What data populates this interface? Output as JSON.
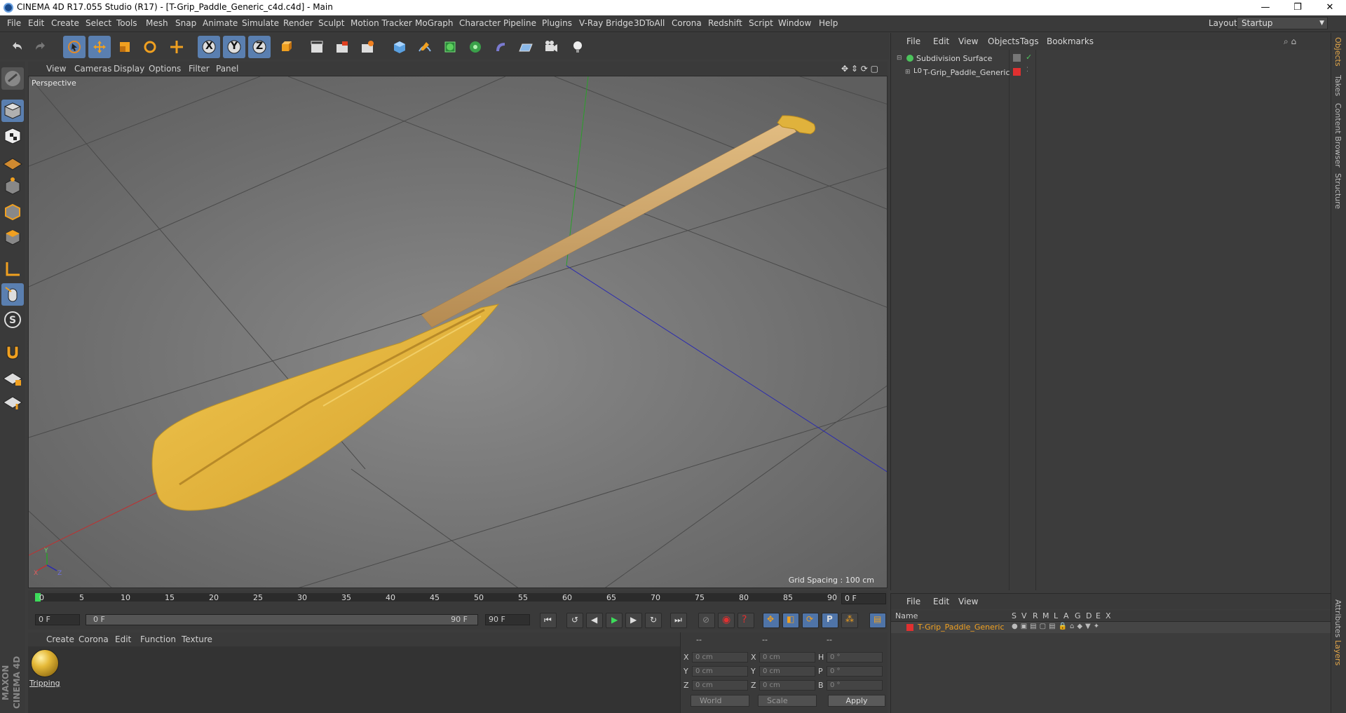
{
  "window": {
    "title": "CINEMA 4D R17.055 Studio (R17) - [T-Grip_Paddle_Generic_c4d.c4d] - Main",
    "controls": {
      "minimize": "—",
      "restore": "❐",
      "close": "✕"
    }
  },
  "menubar": {
    "items": [
      "File",
      "Edit",
      "Create",
      "Select",
      "Tools",
      "Mesh",
      "Snap",
      "Animate",
      "Simulate",
      "Render",
      "Sculpt",
      "Motion Tracker",
      "MoGraph",
      "Character",
      "Pipeline",
      "Plugins",
      "V-Ray Bridge",
      "3DToAll",
      "Corona",
      "Redshift",
      "Script",
      "Window",
      "Help"
    ],
    "layout_label": "Layout:",
    "layout_value": "Startup"
  },
  "toolbar": {
    "axis_labels": [
      "X",
      "Y",
      "Z"
    ]
  },
  "viewport": {
    "menu": [
      "View",
      "Cameras",
      "Display",
      "Options",
      "Filter",
      "Panel"
    ],
    "label": "Perspective",
    "grid_spacing": "Grid Spacing : 100 cm",
    "axis_gizmo": {
      "x": "X",
      "y": "Y",
      "z": "Z"
    },
    "colors": {
      "background": "#6e6e6e",
      "paddle": "#e4b43e",
      "shaft": "#cfa66a",
      "x_axis": "#c03030",
      "y_axis": "#2aa02a",
      "z_axis": "#2a2ab0"
    }
  },
  "timeline": {
    "ticks": [
      "0",
      "5",
      "10",
      "15",
      "20",
      "25",
      "30",
      "35",
      "40",
      "45",
      "50",
      "55",
      "60",
      "65",
      "70",
      "75",
      "80",
      "85",
      "90"
    ],
    "current_frame": "0 F",
    "start": "0 F",
    "range_start": "0 F",
    "range_end": "90 F",
    "end": "90 F"
  },
  "material_manager": {
    "menu": [
      "Create",
      "Corona",
      "Edit",
      "Function",
      "Texture"
    ],
    "materials": [
      {
        "name": "Tripping"
      }
    ]
  },
  "coordinates": {
    "headers": [
      "--",
      "--",
      "--"
    ],
    "rows": [
      {
        "a": "X",
        "a_val": "0 cm",
        "b": "X",
        "b_val": "0 cm",
        "c": "H",
        "c_val": "0 °"
      },
      {
        "a": "Y",
        "a_val": "0 cm",
        "b": "Y",
        "b_val": "0 cm",
        "c": "P",
        "c_val": "0 °"
      },
      {
        "a": "Z",
        "a_val": "0 cm",
        "b": "Z",
        "b_val": "0 cm",
        "c": "B",
        "c_val": "0 °"
      }
    ],
    "mode": "World",
    "type": "Scale",
    "apply": "Apply"
  },
  "object_manager": {
    "menu": [
      "File",
      "Edit",
      "View",
      "Objects",
      "Tags",
      "Bookmarks"
    ],
    "objects": [
      {
        "name": "Subdivision Surface"
      },
      {
        "name": "T-Grip_Paddle_Generic"
      }
    ]
  },
  "layer_manager": {
    "menu": [
      "File",
      "Edit",
      "View"
    ],
    "columns": [
      "Name",
      "S",
      "V",
      "R",
      "M",
      "L",
      "A",
      "G",
      "D",
      "E",
      "X"
    ],
    "layers": [
      {
        "name": "T-Grip_Paddle_Generic",
        "color": "#e03030"
      }
    ]
  },
  "right_tabs": [
    "Objects",
    "Takes",
    "Content Browser",
    "Structure",
    "Attributes",
    "Layers"
  ],
  "branding": "MAXON CINEMA 4D"
}
